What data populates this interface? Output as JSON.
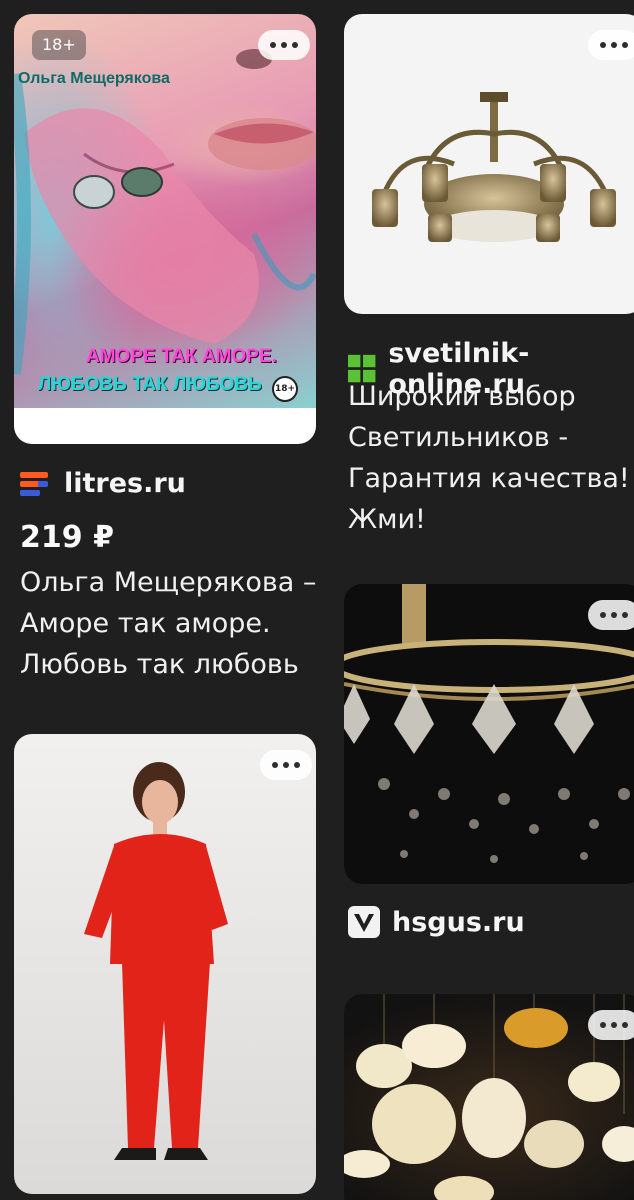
{
  "feed": {
    "cards": [
      {
        "id": "litres",
        "badge": "18+",
        "cover": {
          "author": "Ольга Мещерякова",
          "title_line1": "АМОРЕ ТАК АМОРЕ.",
          "title_line2": "ЛЮБОВЬ ТАК ЛЮБОВЬ",
          "age_mark": "18+"
        },
        "source": "litres.ru",
        "source_icon": "litres-logo-icon",
        "price": "219 ₽",
        "description_lines": [
          "Ольга Мещерякова –",
          "Аморе так аморе.",
          "Любовь так любовь"
        ]
      },
      {
        "id": "svetilnik",
        "image": "chandelier-bronze-photo",
        "source": "svetilnik-online.ru",
        "source_icon": "svetilnik-logo-icon",
        "description_lines": [
          "Широкий выбор",
          "Светильников -",
          "Гарантия качества!",
          "Жми!"
        ]
      },
      {
        "id": "hsgus",
        "image": "crystal-chandelier-photo",
        "source": "hsgus.ru",
        "source_icon": "hsgus-logo-icon"
      },
      {
        "id": "clothing",
        "image": "woman-red-suit-photo"
      },
      {
        "id": "lamps",
        "image": "hanging-lamps-photo"
      }
    ]
  },
  "colors": {
    "background": "#1f1f1f",
    "text": "#f2f2f2",
    "svetilnik_green": "#5bc236",
    "litres_orange": "#ff5a1f",
    "litres_blue": "#3a5bd9",
    "suit_red": "#e2231a"
  }
}
